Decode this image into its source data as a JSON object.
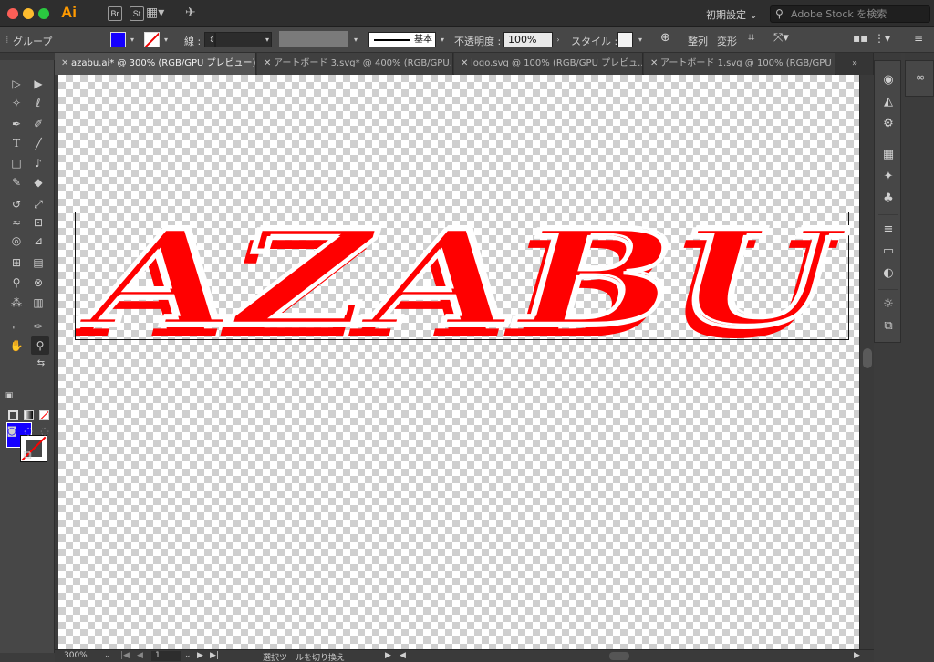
{
  "app": {
    "logo": "Ai",
    "badges": [
      "Br",
      "St"
    ],
    "workspace": "初期設定",
    "stock_search_placeholder": "Adobe Stock を検索"
  },
  "control_bar": {
    "selection_label": "グループ",
    "stroke_label": "線 :",
    "stroke_style": "基本",
    "opacity_label": "不透明度 :",
    "opacity_value": "100%",
    "style_label": "スタイル :",
    "align_label": "整列",
    "transform_label": "変形",
    "fill_color": "#1400ff",
    "stroke_color": "none"
  },
  "tabs": [
    {
      "label": "azabu.ai* @ 300% (RGB/GPU プレビュー)",
      "active": true
    },
    {
      "label": "アートボード 3.svg* @ 400% (RGB/GPU...",
      "active": false
    },
    {
      "label": "logo.svg @ 100% (RGB/GPU プレビュ...",
      "active": false
    },
    {
      "label": "アートボード 1.svg @ 100% (RGB/GPU ...",
      "active": false
    }
  ],
  "artwork": {
    "text": "AZABU",
    "color": "#ff0000"
  },
  "status_bar": {
    "zoom": "300%",
    "page": "1",
    "status_text": "選択ツールを切り換え"
  },
  "icons": {
    "tools": [
      "selection-tool",
      "direct-selection-tool",
      "magic-wand-tool",
      "lasso-tool",
      "pen-tool",
      "curvature-tool",
      "type-tool",
      "line-tool",
      "rectangle-tool",
      "paintbrush-tool",
      "shaper-tool",
      "eraser-tool",
      "rotate-tool",
      "scale-tool",
      "width-tool",
      "free-transform-tool",
      "shape-builder-tool",
      "perspective-grid-tool",
      "mesh-tool",
      "gradient-tool",
      "eyedropper-tool",
      "blend-tool",
      "symbol-sprayer-tool",
      "column-graph-tool",
      "artboard-tool",
      "slice-tool",
      "hand-tool",
      "zoom-tool"
    ],
    "right_panels": [
      "color-panel",
      "color-guide-panel",
      "appearance-panel",
      "swatches-panel",
      "brushes-panel",
      "symbols-panel",
      "stroke-panel",
      "gradient-panel",
      "transparency-panel",
      "properties-panel",
      "asset-export-panel",
      "creative-cloud-libraries"
    ]
  }
}
